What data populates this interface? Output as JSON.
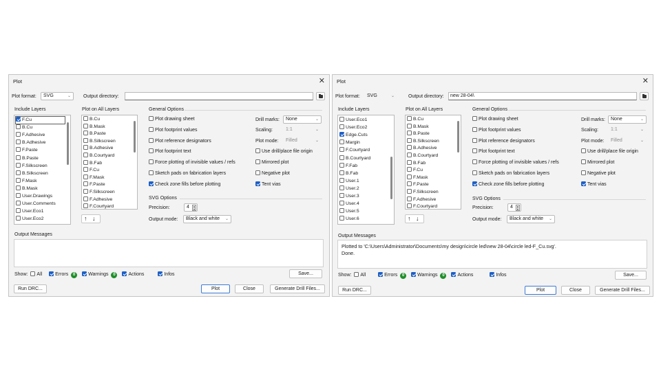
{
  "left": {
    "title": "Plot",
    "plot_format_label": "Plot format:",
    "plot_format_value": "SVG",
    "output_dir_label": "Output directory:",
    "output_dir_value": "",
    "include_layers_label": "Include Layers",
    "include_layers": [
      {
        "label": "F.Cu",
        "checked": true,
        "selected": true
      },
      {
        "label": "B.Cu",
        "checked": false
      },
      {
        "label": "F.Adhesive",
        "checked": false
      },
      {
        "label": "B.Adhesive",
        "checked": false
      },
      {
        "label": "F.Paste",
        "checked": false
      },
      {
        "label": "B.Paste",
        "checked": false
      },
      {
        "label": "F.Silkscreen",
        "checked": false
      },
      {
        "label": "B.Silkscreen",
        "checked": false
      },
      {
        "label": "F.Mask",
        "checked": false
      },
      {
        "label": "B.Mask",
        "checked": false
      },
      {
        "label": "User.Drawings",
        "checked": false
      },
      {
        "label": "User.Comments",
        "checked": false
      },
      {
        "label": "User.Eco1",
        "checked": false
      },
      {
        "label": "User.Eco2",
        "checked": false
      }
    ],
    "plot_on_all_label": "Plot on All Layers",
    "plot_on_all": [
      "B.Cu",
      "B.Mask",
      "B.Paste",
      "B.Silkscreen",
      "B.Adhesive",
      "B.Courtyard",
      "B.Fab",
      "F.Cu",
      "F.Mask",
      "F.Paste",
      "F.Silkscreen",
      "F.Adhesive",
      "F.Courtyard"
    ],
    "general_options_label": "General Options",
    "options_left": [
      {
        "label": "Plot drawing sheet",
        "checked": false
      },
      {
        "label": "Plot footprint values",
        "checked": false
      },
      {
        "label": "Plot reference designators",
        "checked": false
      },
      {
        "label": "Plot footprint text",
        "checked": false
      },
      {
        "label": "Force plotting of invisible values / refs",
        "checked": false
      },
      {
        "label": "Sketch pads on fabrication layers",
        "checked": false
      },
      {
        "label": "Check zone fills before plotting",
        "checked": true
      }
    ],
    "drill_marks_label": "Drill marks:",
    "drill_marks_value": "None",
    "scaling_label": "Scaling:",
    "scaling_value": "1:1",
    "plot_mode_label": "Plot mode:",
    "plot_mode_value": "Filled",
    "options_right": [
      {
        "label": "Use drill/place file origin",
        "checked": false
      },
      {
        "label": "Mirrored plot",
        "checked": false
      },
      {
        "label": "Negative plot",
        "checked": false
      },
      {
        "label": "Tent vias",
        "checked": true
      }
    ],
    "svg_options_label": "SVG Options",
    "precision_label": "Precision:",
    "precision_value": "4",
    "output_mode_label": "Output mode:",
    "output_mode_value": "Black and white",
    "output_messages_label": "Output Messages",
    "messages": [
      "",
      ""
    ],
    "show_label": "Show:",
    "filter_all": "All",
    "filter_errors": "Errors",
    "errors_count": "0",
    "filter_warnings": "Warnings",
    "warnings_count": "0",
    "filter_actions": "Actions",
    "filter_infos": "Infos",
    "save_button": "Save...",
    "run_drc_button": "Run DRC...",
    "plot_button": "Plot",
    "close_button": "Close",
    "generate_drill_button": "Generate Drill Files..."
  },
  "right": {
    "title": "Plot",
    "plot_format_label": "Plot format:",
    "plot_format_value": "SVG",
    "output_dir_label": "Output directory:",
    "output_dir_value": "new 28-04\\",
    "include_layers_label": "Include Layers",
    "include_layers": [
      {
        "label": "User.Eco1",
        "checked": false
      },
      {
        "label": "User.Eco2",
        "checked": false
      },
      {
        "label": "Edge.Cuts",
        "checked": true
      },
      {
        "label": "Margin",
        "checked": false
      },
      {
        "label": "F.Courtyard",
        "checked": false
      },
      {
        "label": "B.Courtyard",
        "checked": false
      },
      {
        "label": "F.Fab",
        "checked": false
      },
      {
        "label": "B.Fab",
        "checked": false
      },
      {
        "label": "User.1",
        "checked": false
      },
      {
        "label": "User.2",
        "checked": false
      },
      {
        "label": "User.3",
        "checked": false
      },
      {
        "label": "User.4",
        "checked": false
      },
      {
        "label": "User.5",
        "checked": false
      },
      {
        "label": "User.6",
        "checked": false
      }
    ],
    "plot_on_all_label": "Plot on All Layers",
    "plot_on_all": [
      "B.Cu",
      "B.Mask",
      "B.Paste",
      "B.Silkscreen",
      "B.Adhesive",
      "B.Courtyard",
      "B.Fab",
      "F.Cu",
      "F.Mask",
      "F.Paste",
      "F.Silkscreen",
      "F.Adhesive",
      "F.Courtyard"
    ],
    "general_options_label": "General Options",
    "options_left": [
      {
        "label": "Plot drawing sheet",
        "checked": false
      },
      {
        "label": "Plot footprint values",
        "checked": false
      },
      {
        "label": "Plot reference designators",
        "checked": false
      },
      {
        "label": "Plot footprint text",
        "checked": false
      },
      {
        "label": "Force plotting of invisible values / refs",
        "checked": false
      },
      {
        "label": "Sketch pads on fabrication layers",
        "checked": false
      },
      {
        "label": "Check zone fills before plotting",
        "checked": true
      }
    ],
    "drill_marks_label": "Drill marks:",
    "drill_marks_value": "None",
    "scaling_label": "Scaling:",
    "scaling_value": "1:1",
    "plot_mode_label": "Plot mode:",
    "plot_mode_value": "Filled",
    "options_right": [
      {
        "label": "Use drill/place file origin",
        "checked": false
      },
      {
        "label": "Mirrored plot",
        "checked": false
      },
      {
        "label": "Negative plot",
        "checked": false
      },
      {
        "label": "Tent vias",
        "checked": true
      }
    ],
    "svg_options_label": "SVG Options",
    "precision_label": "Precision:",
    "precision_value": "4",
    "output_mode_label": "Output mode:",
    "output_mode_value": "Black and white",
    "output_messages_label": "Output Messages",
    "messages": [
      "Plotted to 'C:\\Users\\Administrator\\Documents\\my design\\circle led\\new 28-04\\circle led-F_Cu.svg'.",
      "Done."
    ],
    "show_label": "Show:",
    "filter_all": "All",
    "filter_errors": "Errors",
    "errors_count": "0",
    "filter_warnings": "Warnings",
    "warnings_count": "0",
    "filter_actions": "Actions",
    "filter_infos": "Infos",
    "save_button": "Save...",
    "run_drc_button": "Run DRC...",
    "plot_button": "Plot",
    "close_button": "Close",
    "generate_drill_button": "Generate Drill Files..."
  },
  "colors": {
    "accent": "#1d5fc5",
    "badge_green": "#1f8f2a",
    "dialog_bg": "#f3f3f3"
  }
}
